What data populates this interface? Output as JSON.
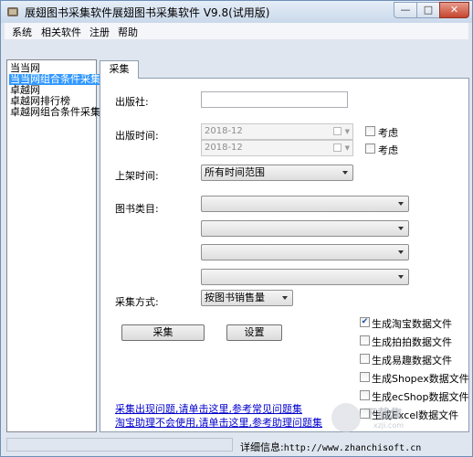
{
  "window": {
    "title": "展翅图书采集软件展翅图书采集软件 V9.8(试用版)",
    "minimize_glyph": "—",
    "maximize_glyph": "□",
    "close_glyph": "✕"
  },
  "menu": [
    "系统",
    "相关软件",
    "注册",
    "帮助"
  ],
  "tree": {
    "items": [
      "当当网",
      "当当网组合条件采集",
      "卓越网",
      "卓越网排行榜",
      "卓越网组合条件采集"
    ],
    "selected_index": 1
  },
  "tab": {
    "label": "采集"
  },
  "form": {
    "publisher": {
      "label": "出版社:",
      "value": ""
    },
    "publish_time": {
      "label": "出版时间:",
      "from": "2018-12",
      "to": "2018-12",
      "consider_label_1": "考虑",
      "consider_label_2": "考虑",
      "consider_checked_1": false,
      "consider_checked_2": false
    },
    "shelf_time": {
      "label": "上架时间:",
      "value": "所有时间范围"
    },
    "category": {
      "label": "图书类目:",
      "values": [
        "",
        "",
        "",
        ""
      ]
    },
    "method": {
      "label": "采集方式:",
      "value": "按图书销售量"
    }
  },
  "buttons": {
    "collect": "采集",
    "settings": "设置"
  },
  "options": [
    {
      "label": "生成淘宝数据文件",
      "checked": true
    },
    {
      "label": "生成拍拍数据文件",
      "checked": false
    },
    {
      "label": "生成易趣数据文件",
      "checked": false
    },
    {
      "label": "生成Shopex数据文件",
      "checked": false
    },
    {
      "label": "生成ecShop数据文件",
      "checked": false
    },
    {
      "label": "生成Excel数据文件",
      "checked": false
    }
  ],
  "links": {
    "problem": "采集出现问题,请单击这里,参考常见问题集",
    "help": "淘宝助理不会使用,请单击这里,参考助理问题集"
  },
  "status": {
    "label": "详细信息:",
    "url": "http://www.zhanchisoft.cn"
  },
  "watermark": {
    "text": "下载集",
    "sub": "xzji.com"
  },
  "colors": {
    "selection": "#3399ff",
    "link": "#0000cc",
    "frame": "#dfe6ef"
  }
}
